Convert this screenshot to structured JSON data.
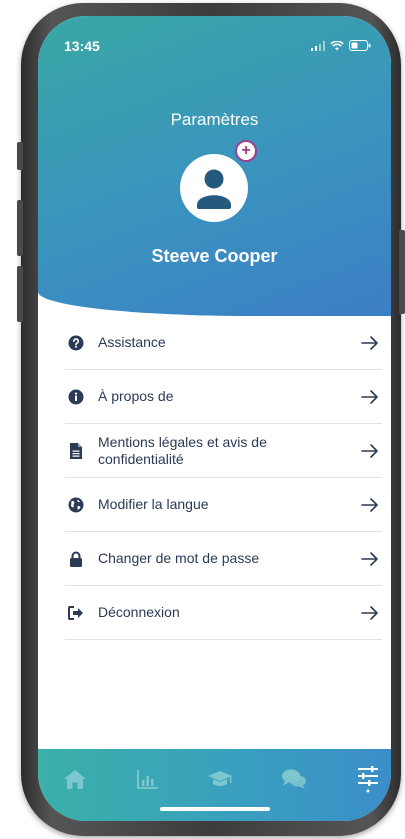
{
  "status_bar": {
    "time": "13:45"
  },
  "header": {
    "title": "Paramètres",
    "user_name": "Steeve Cooper"
  },
  "menu": [
    {
      "label": "Assistance",
      "icon": "question-circle-icon"
    },
    {
      "label": "À propos de",
      "icon": "info-circle-icon"
    },
    {
      "label": "Mentions légales et avis de confidentialité",
      "icon": "document-icon"
    },
    {
      "label": "Modifier la langue",
      "icon": "globe-icon"
    },
    {
      "label": "Changer de mot de passe",
      "icon": "lock-icon"
    },
    {
      "label": "Déconnexion",
      "icon": "sign-out-icon"
    }
  ],
  "tab_bar": {
    "tabs": [
      {
        "icon": "home-icon",
        "active": false
      },
      {
        "icon": "bar-chart-icon",
        "active": false
      },
      {
        "icon": "graduation-cap-icon",
        "active": false
      },
      {
        "icon": "chat-bubbles-icon",
        "active": false
      },
      {
        "icon": "settings-sliders-icon",
        "active": true
      }
    ]
  },
  "colors": {
    "header_gradient_start": "#3aa7a5",
    "header_gradient_end": "#3c7ec5",
    "menu_text": "#2b3a55",
    "avatar_icon": "#235a7e",
    "badge_accent": "#a13c8f",
    "tab_inactive": "#7fc7cf",
    "tab_active": "#ffffff"
  }
}
